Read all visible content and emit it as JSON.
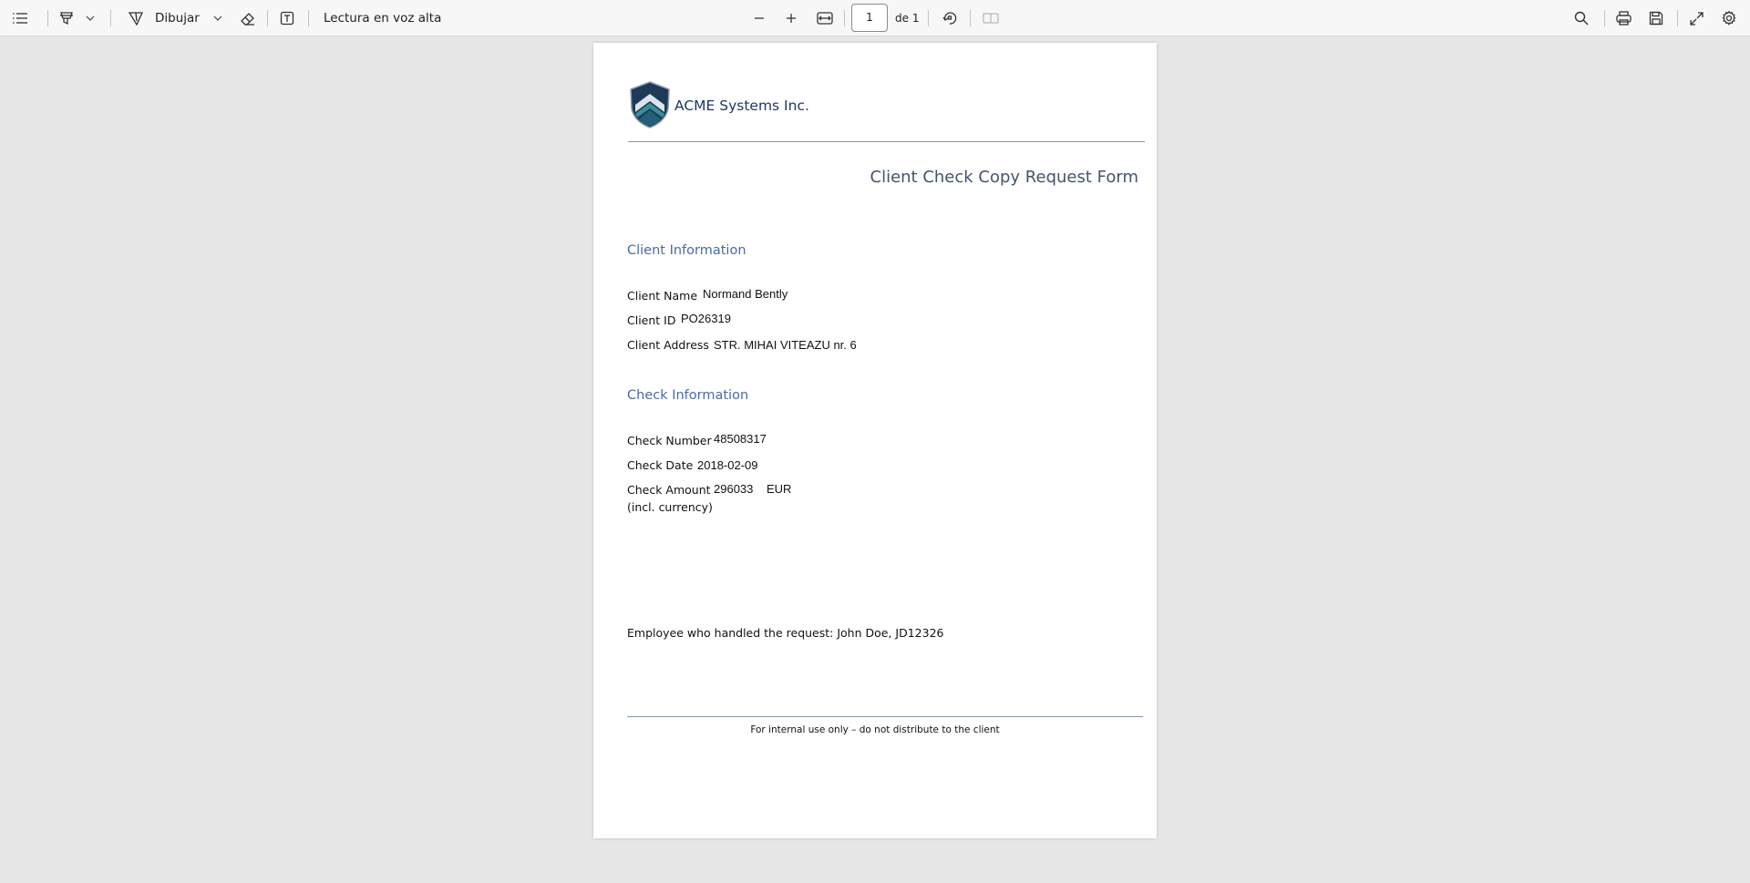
{
  "toolbar": {
    "draw_label": "Dibujar",
    "read_aloud_label": "Lectura en voz alta",
    "page_current": "1",
    "page_total_label": "de 1"
  },
  "document": {
    "company_name": "ACME Systems Inc.",
    "form_title": "Client Check Copy Request Form",
    "client_section": {
      "heading": "Client Information",
      "name_label": "Client Name",
      "name_value": "Normand Bently",
      "id_label": "Client ID",
      "id_value": "PO26319",
      "address_label": "Client Address",
      "address_value": "STR. MIHAI VITEAZU nr. 6"
    },
    "check_section": {
      "heading": "Check Information",
      "number_label": "Check Number",
      "number_value": "48508317",
      "date_label": "Check Date",
      "date_value": "2018-02-09",
      "amount_label": "Check Amount",
      "amount_sublabel": "(incl. currency)",
      "amount_value": "296033",
      "currency_value": "EUR"
    },
    "employee_line": "Employee who handled the request: John Doe, JD12326",
    "footer_note": "For internal use only – do not distribute to the client"
  },
  "colors": {
    "accent_heading": "#4a6aa3",
    "rule": "#8497b0",
    "company": "#1f3864"
  }
}
